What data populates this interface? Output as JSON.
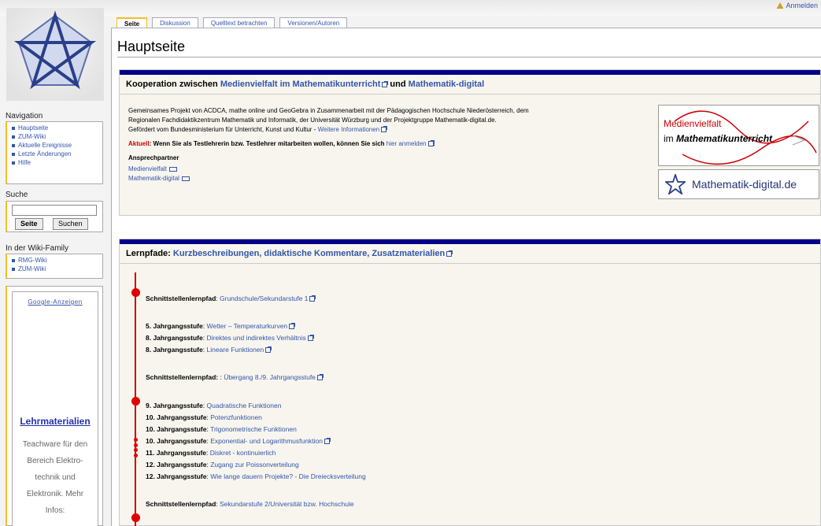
{
  "header": {
    "user_link": "Anmelden"
  },
  "tabs": [
    {
      "label": "Seite",
      "selected": true
    },
    {
      "label": "Diskussion",
      "selected": false
    },
    {
      "label": "Quelltext betrachten",
      "selected": false
    },
    {
      "label": "Versionen/Autoren",
      "selected": false
    }
  ],
  "page_title": "Hauptseite",
  "navigation": {
    "title": "Navigation",
    "items": [
      "Hauptseite",
      "ZUM-Wiki",
      "Aktuelle Ereignisse",
      "Letzte Änderungen",
      "Hilfe"
    ]
  },
  "search": {
    "title": "Suche",
    "go_label": "Seite",
    "search_label": "Suchen",
    "value": ""
  },
  "family": {
    "title": "In der Wiki-Family",
    "items": [
      "RMG-Wiki",
      "ZUM-Wiki"
    ]
  },
  "ad": {
    "header": "Google-Anzeigen",
    "headline": "Lehrmaterialien",
    "text": "Teachware für den Bereich Elektro-technik und Elektronik. Mehr Infos:"
  },
  "box1": {
    "title_prefix": "Kooperation zwischen",
    "title_link1": "Medienvielfalt im Mathematikunterricht",
    "title_mid": "und",
    "title_link2": "Mathematik-digital",
    "para1": "Gemeinsames Projekt von ACDCA, mathe online und GeoGebra in Zusammenarbeit mit der Pädagogischen Hochschule Niederösterreich, dem",
    "para2": "Regionalen Fachdidaktikzentrum Mathematik und Informatik, der Universität Würzburg und der Projektgruppe Mathematik-digital.de.",
    "para3": "Gefördert vom Bundesministerium für Unterricht, Kunst und Kultur -",
    "para3_link": "Weitere Informationen",
    "aktuell_label": "Aktuell",
    "aktuell_text": ": Wenn Sie als Testlehrerin bzw. Testlehrer mitarbeiten wollen, können Sie sich",
    "aktuell_link": "hier anmelden",
    "contact_heading": "Ansprechpartner",
    "contacts": [
      "Medienvielfalt",
      "Mathematik-digital"
    ],
    "logo1_line1": "Medienvielfalt",
    "logo1_line2_prefix": "im",
    "logo1_line2_bold": "Mathematikunterricht",
    "logo2_text": "Mathematik-digital.de"
  },
  "box2": {
    "title_prefix": "Lernpfade:",
    "title_link": "Kurzbeschreibungen, didaktische Kommentare, Zusatzmaterialien",
    "rows": [
      {
        "label": "Schnittstellenlernpfad",
        "sep": ": ",
        "link": "Grundschule/Sekundarstufe 1",
        "ext": true
      },
      {
        "label": "5. Jahrgangsstufe",
        "sep": ": ",
        "link": "Wetter – Temperaturkurven",
        "ext": true
      },
      {
        "label": "8. Jahrgangsstufe",
        "sep": ": ",
        "link": "Direktes und indirektes Verhältnis",
        "ext": true
      },
      {
        "label": "8. Jahrgangsstufe",
        "sep": ": ",
        "link": "Lineare Funktionen",
        "ext": true
      },
      {
        "label": "Schnittstellenlernpfad:",
        "sep": " : ",
        "link": "Übergang 8./9. Jahrgangsstufe",
        "ext": true
      },
      {
        "label": "9. Jahrgangsstufe",
        "sep": ": ",
        "link": "Quadratische Funktionen",
        "ext": false
      },
      {
        "label": "10. Jahrgangsstufe",
        "sep": ": ",
        "link": "Potenzfunktionen",
        "ext": false
      },
      {
        "label": "10. Jahrgangsstufe",
        "sep": ": ",
        "link": "Trigonometrische Funktionen",
        "ext": false
      },
      {
        "label": "10. Jahrgangsstufe",
        "sep": ": ",
        "link": "Exponential- und Logarithmusfunktion",
        "ext": true
      },
      {
        "label": "11. Jahrgangsstufe",
        "sep": ": ",
        "link": "Diskret - kontinuierlich",
        "ext": false
      },
      {
        "label": "12. Jahrgangsstufe",
        "sep": ": ",
        "link": "Zugang zur Poissonverteilung",
        "ext": false
      },
      {
        "label": "12. Jahrgangsstufe",
        "sep": ": ",
        "link": "Wie lange dauern Projekte? - Die Dreiecksverteilung",
        "ext": false
      },
      {
        "label": "Schnittstellenlernpfad",
        "sep": ": ",
        "link": "Sekundarstufe 2/Universität bzw. Hochschule",
        "ext": false
      }
    ]
  }
}
